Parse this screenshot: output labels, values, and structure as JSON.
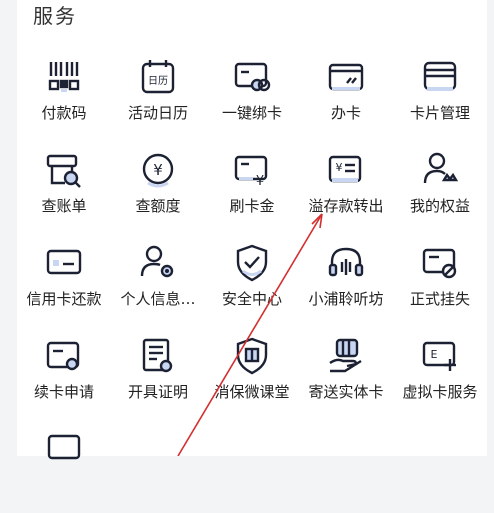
{
  "section": {
    "title": "服务"
  },
  "colors": {
    "icon": "#1c2233",
    "accent": "#c9d6f2",
    "arrow": "#d32f2f"
  },
  "items": [
    {
      "label": "付款码",
      "icon": "qr-barcode-icon"
    },
    {
      "label": "活动日历",
      "icon": "calendar-icon"
    },
    {
      "label": "一键绑卡",
      "icon": "card-link-icon"
    },
    {
      "label": "办卡",
      "icon": "card-apply-icon"
    },
    {
      "label": "卡片管理",
      "icon": "cards-stack-icon"
    },
    {
      "label": "查账单",
      "icon": "bill-search-icon"
    },
    {
      "label": "查额度",
      "icon": "yuan-coin-icon"
    },
    {
      "label": "刷卡金",
      "icon": "card-yuan-icon"
    },
    {
      "label": "溢存款转出",
      "icon": "yuan-transfer-icon"
    },
    {
      "label": "我的权益",
      "icon": "user-crown-icon"
    },
    {
      "label": "信用卡还款",
      "icon": "credit-card-repay-icon"
    },
    {
      "label": "个人信息…",
      "icon": "user-settings-icon"
    },
    {
      "label": "安全中心",
      "icon": "shield-check-icon"
    },
    {
      "label": "小浦聆听坊",
      "icon": "headset-icon"
    },
    {
      "label": "正式挂失",
      "icon": "card-block-icon"
    },
    {
      "label": "续卡申请",
      "icon": "card-renew-icon"
    },
    {
      "label": "开具证明",
      "icon": "certificate-icon"
    },
    {
      "label": "消保微课堂",
      "icon": "shield-book-icon"
    },
    {
      "label": "寄送实体卡",
      "icon": "hand-card-icon"
    },
    {
      "label": "虚拟卡服务",
      "icon": "virtual-card-icon"
    }
  ]
}
